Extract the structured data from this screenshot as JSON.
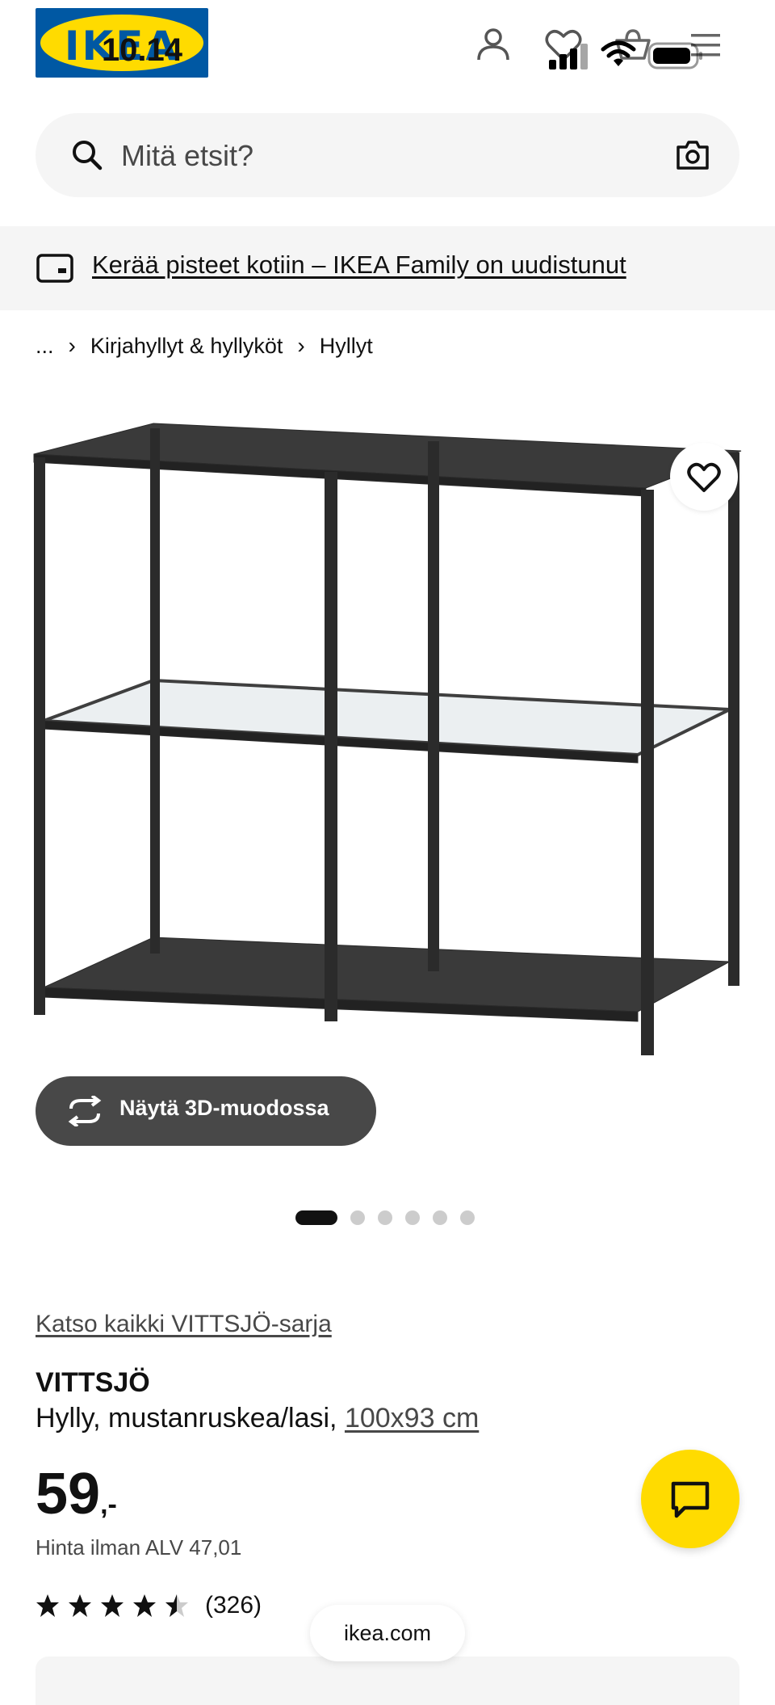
{
  "status_bar": {
    "time": "10.14"
  },
  "header": {
    "logo_text": "IKEA",
    "icons": [
      "user-icon",
      "heart-icon",
      "cart-icon",
      "menu-icon"
    ]
  },
  "search": {
    "placeholder": "Mitä etsit?"
  },
  "promo": {
    "text": "Kerää pisteet kotiin – IKEA Family on uudistunut"
  },
  "breadcrumb": {
    "ellipsis": "...",
    "items": [
      "Kirjahyllyt & hyllyköt",
      "Hyllyt"
    ]
  },
  "gallery": {
    "view_3d_label": "Näytä 3D-muodossa",
    "image_count": 6,
    "active_index": 0
  },
  "product": {
    "series_link": "Katso kaikki VITTSJÖ-sarja",
    "name": "VITTSJÖ",
    "description": "Hylly, mustanruskea/lasi,",
    "size": "100x93 cm",
    "price_whole": "59",
    "price_suffix": ",-",
    "vat_text": "Hinta ilman ALV 47,01",
    "rating": 4.5,
    "review_count": "(326)"
  },
  "browser": {
    "url": "ikea.com"
  },
  "colors": {
    "brand_blue": "#0058a3",
    "brand_yellow": "#ffdb00",
    "text_dark": "#111111",
    "text_grey": "#484848",
    "surface": "#f5f5f5"
  }
}
